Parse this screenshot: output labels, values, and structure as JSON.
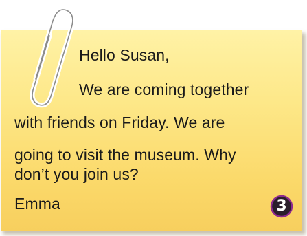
{
  "note": {
    "lines": [
      "Hello Susan,",
      "We are coming together",
      "with friends on Friday. We are",
      "going to visit the museum. Why",
      "don’t you join us?",
      "Emma"
    ]
  },
  "badge": {
    "number": "3"
  },
  "colors": {
    "note_top": "#fff2a6",
    "note_bottom": "#f7cf5e",
    "badge_fill": "#2b1e2c",
    "badge_ring": "#8e2a8f",
    "text": "#1a1a1a"
  },
  "icons": {
    "clip": "paperclip-icon"
  }
}
